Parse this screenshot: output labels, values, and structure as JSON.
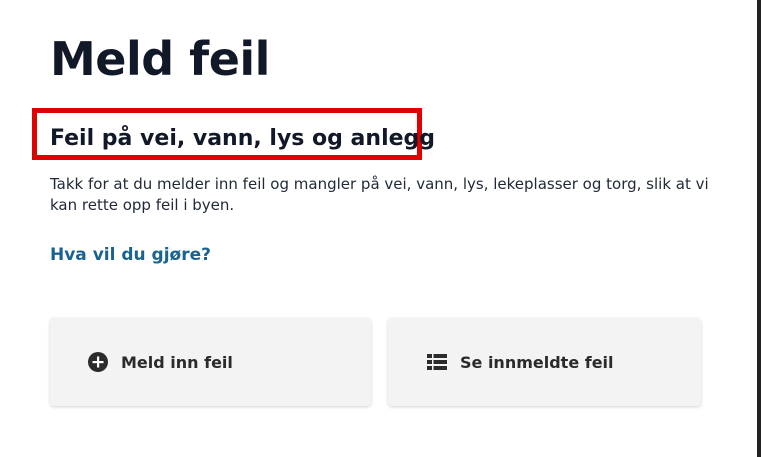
{
  "page": {
    "title": "Meld feil"
  },
  "section": {
    "heading": "Feil på vei, vann, lys og anlegg",
    "intro": "Takk for at du melder inn feil og mangler på vei, vann, lys, lekeplasser og torg, slik at vi kan rette opp feil i byen.",
    "question": "Hva vil du gjøre?"
  },
  "actions": [
    {
      "label": "Meld inn feil",
      "icon": "plus-circle-icon"
    },
    {
      "label": "Se innmeldte feil",
      "icon": "list-icon"
    }
  ],
  "colors": {
    "highlight": "#e10000",
    "link": "#1a6391",
    "card_bg": "#f3f3f3",
    "text": "#111827"
  }
}
